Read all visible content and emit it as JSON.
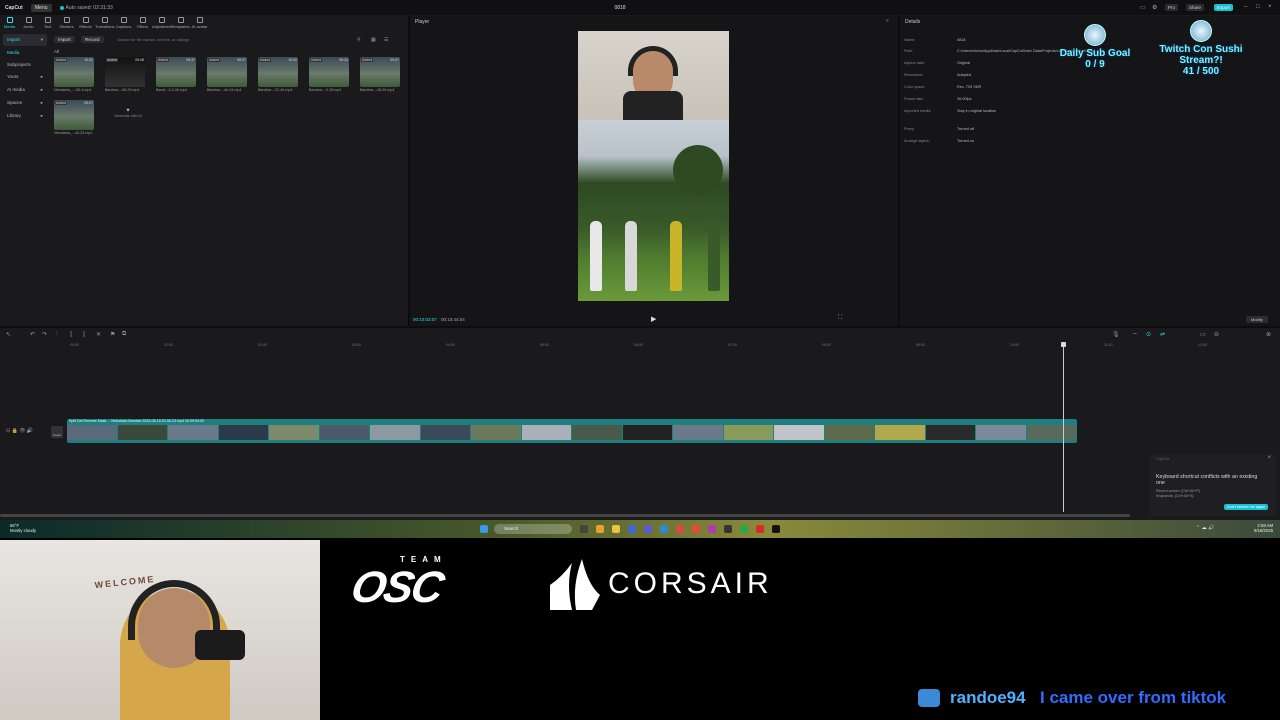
{
  "app": {
    "logo": "CapCut",
    "menu_label": "Menu",
    "autosave": "Auto saved: 02:31:33",
    "project_title": "0818",
    "header_buttons": [
      "Pro",
      "Share",
      "Export"
    ]
  },
  "toolbar": {
    "tools": [
      "Media",
      "Audio",
      "Text",
      "Stickers",
      "Effects",
      "Transitions",
      "Captions",
      "Filters",
      "Adjustment",
      "Templates",
      "AI avatar"
    ]
  },
  "sidebar": {
    "items": [
      {
        "label": "Import"
      },
      {
        "label": "Media"
      },
      {
        "label": "Subprojects"
      },
      {
        "label": "Yours"
      },
      {
        "label": "AI media"
      },
      {
        "label": "Spaces"
      },
      {
        "label": "Library"
      }
    ]
  },
  "media": {
    "import_label": "Import",
    "record_label": "Record",
    "search_placeholder": "Search for file names, scenes, or dialogs",
    "all_label": "All",
    "items": [
      {
        "added": "Added",
        "duration": "10:02",
        "name": "Nebulaxia_...-06-4.mp4"
      },
      {
        "added": "Added",
        "duration": "09:08",
        "name": "Bandwa...-06-29.mp4"
      },
      {
        "added": "Added",
        "duration": "09:37",
        "name": "Bandr...3-0-45.mp4"
      },
      {
        "added": "Added",
        "duration": "09:07",
        "name": "Bandwa...-4e-04.mp4"
      },
      {
        "added": "Added",
        "duration": "10:00",
        "name": "Bandwa...-02-45.mp4"
      },
      {
        "added": "Added",
        "duration": "09:34",
        "name": "Bandwa...-0-28.mp4"
      },
      {
        "added": "Added",
        "duration": "09:07",
        "name": "Bandwa...-48-59.mp4"
      },
      {
        "added": "Added",
        "duration": "09:07",
        "name": "Nebulaxia_...06-33.mp4"
      }
    ],
    "generate_label": "Generate with AI"
  },
  "player": {
    "title": "Player",
    "current_time": "00:10:03:07",
    "total_time": "00:10:44:04"
  },
  "details": {
    "title": "Details",
    "rows": [
      {
        "label": "Name:",
        "value": "0818"
      },
      {
        "label": "Path:",
        "value": "C:/Users/shcho/AppData/Local/CapCut/User Data/Projects/com.lveditor.draft/0818"
      },
      {
        "label": "Aspect ratio:",
        "value": "Original"
      },
      {
        "label": "Resolution:",
        "value": "Adapted"
      },
      {
        "label": "Color space:",
        "value": "Rec. 709 SDR"
      },
      {
        "label": "Frame rate:",
        "value": "30.00fps"
      },
      {
        "label": "Imported media:",
        "value": "Stay in original location"
      },
      {
        "label": "Proxy:",
        "value": "Turned off"
      },
      {
        "label": "Arrange layers:",
        "value": "Turned on"
      }
    ],
    "modify_label": "Modify"
  },
  "overlays": {
    "daily_goal": {
      "title": "Daily Sub Goal",
      "value": "0 / 9"
    },
    "twitch_goal": {
      "title": "Twitch Con Sushi Stream?!",
      "value": "41 / 500"
    }
  },
  "timeline": {
    "ruler_ticks": [
      "00:00",
      "01:00",
      "02:00",
      "03:00",
      "04:00",
      "05:00",
      "06:00",
      "07:00",
      "08:00",
      "09:00",
      "10:00",
      "11:00",
      "12:00"
    ],
    "track_label": "Split  Del  Reverse  Mask  ...  Nebulaxia  Bandwa 2025-08-18 20-56-23.mp4  00:09:54:03",
    "cover_label": "Cover"
  },
  "toast": {
    "app": "CapCut",
    "title": "Keyboard shortcut conflicts with an existing one",
    "lines": [
      "Record screen: [Ctrl+Alt+P]",
      "Snapshots: [Ctrl+Alt+S]"
    ],
    "button": "Don't remind me again"
  },
  "taskbar": {
    "weather_temp": "66°F",
    "weather_desc": "Mostly cloudy",
    "search_placeholder": "Search",
    "time": "2:59 AM",
    "date": "8/18/2025"
  },
  "stream": {
    "banner": "WELCOME",
    "team_label": "TEAM",
    "osc_label": "OSC",
    "corsair_label": "CORSAIR",
    "chat_user": "randoe94",
    "chat_message": "I came over from tiktok"
  },
  "colors": {
    "accent": "#2ee0e8",
    "chat_user": "#4fb3ff",
    "chat_msg": "#2f6cff",
    "goal_text": "#7ff0ff"
  }
}
